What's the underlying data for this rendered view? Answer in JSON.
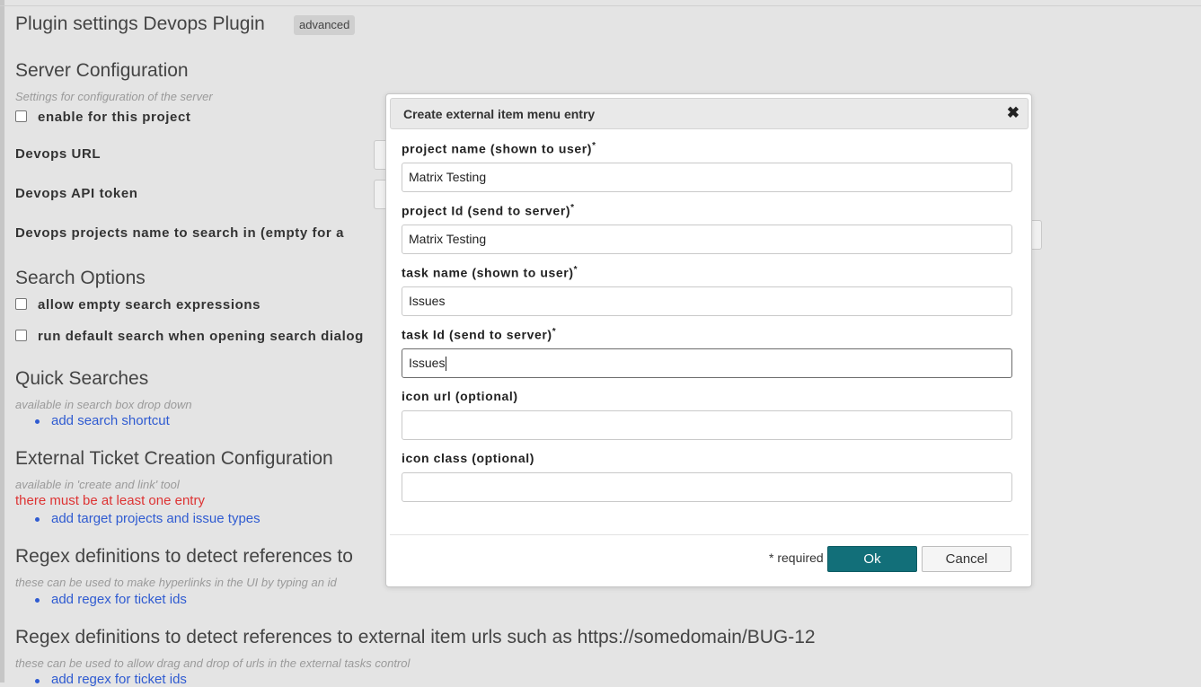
{
  "page": {
    "title": "Plugin settings Devops Plugin",
    "badge": "advanced"
  },
  "server_config": {
    "heading": "Server Configuration",
    "hint": "Settings for configuration of the server",
    "enable_label": "enable for this project",
    "url_label": "Devops URL",
    "token_label": "Devops API token",
    "projects_label": "Devops projects name to search in (empty for a"
  },
  "search_options": {
    "heading": "Search Options",
    "allow_empty_label": "allow empty search expressions",
    "run_default_label": "run default search when opening search dialog"
  },
  "quick_searches": {
    "heading": "Quick Searches",
    "hint": "available in search box drop down",
    "add_link": "add search shortcut"
  },
  "external_ticket": {
    "heading": "External Ticket Creation Configuration",
    "hint": "available in 'create and link' tool",
    "error": "there must be at least one entry",
    "add_link": "add target projects and issue types"
  },
  "regex_refs": {
    "heading": "Regex definitions to detect references to",
    "hint": "these can be used to make hyperlinks in the UI by typing an id",
    "add_link": "add regex for ticket ids"
  },
  "regex_urls": {
    "heading": "Regex definitions to detect references to external item urls such as https://somedomain/BUG-12",
    "hint": "these can be used to allow drag and drop of urls in the external tasks control",
    "add_link": "add regex for ticket ids"
  },
  "dialog": {
    "title": "Create external item menu entry",
    "close_glyph": "✖",
    "fields": [
      {
        "label": "project name (shown to user)",
        "required": "*",
        "value": "Matrix Testing",
        "placeholder": ""
      },
      {
        "label": "project Id (send to server)",
        "required": "*",
        "value": "Matrix Testing",
        "placeholder": ""
      },
      {
        "label": "task name (shown to user)",
        "required": "*",
        "value": "Issues",
        "placeholder": ""
      },
      {
        "label": "task Id (send to server)",
        "required": "*",
        "value": "Issues",
        "placeholder": ""
      },
      {
        "label": "icon url (optional)",
        "required": "",
        "value": "",
        "placeholder": ""
      },
      {
        "label": "icon class (optional)",
        "required": "",
        "value": "",
        "placeholder": ""
      }
    ],
    "required_note": "* required",
    "ok_label": "Ok",
    "cancel_label": "Cancel"
  },
  "colors": {
    "accent": "#126f79",
    "link": "#2f5bd1",
    "error": "#dd3333",
    "background": "#e4e4e4"
  },
  "icons": [
    "close-icon"
  ]
}
